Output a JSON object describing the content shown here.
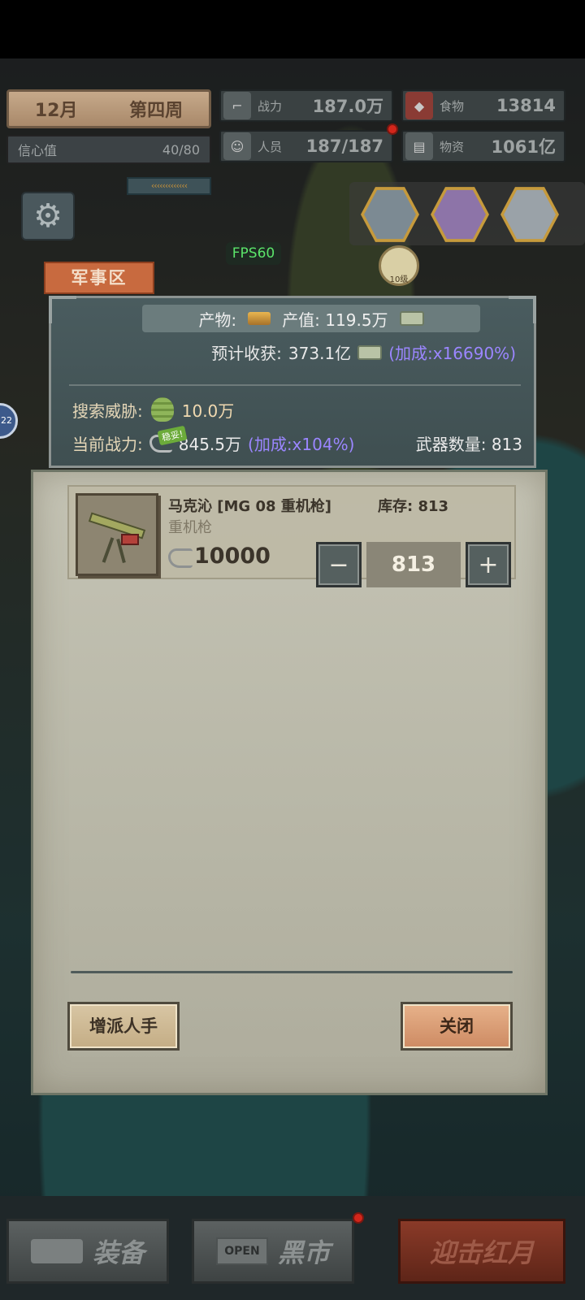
{
  "hud": {
    "month": "12月",
    "week": "第四周",
    "faith_label": "信心值",
    "faith_value": "40/80",
    "power_label": "战力",
    "power_value": "187.0万",
    "food_label": "食物",
    "food_value": "13814",
    "people_label": "人员",
    "people_value": "187/187",
    "supplies_label": "物资",
    "supplies_value": "1061亿"
  },
  "overlay": {
    "fps": "FPS60",
    "flag_level": "10级",
    "side_badge": "22"
  },
  "zone": {
    "name": "军事区"
  },
  "info": {
    "product_label": "产物:",
    "output_label": "产值: 119.5万",
    "expected_label": "预计收获:",
    "expected_value": "373.1亿",
    "expected_bonus": "(加成:x16690%)",
    "threat_label": "搜索威胁:",
    "threat_value": "10.0万",
    "safe_tag": "稳妥!",
    "current_power_label": "当前战力:",
    "current_power_value": "845.5万",
    "current_power_bonus": "(加成:x104%)",
    "weapon_count": "武器数量: 813"
  },
  "weapon": {
    "name": "马克沁 [MG 08 重机枪]",
    "stock": "库存:   813",
    "type": "重机枪",
    "power": "10000",
    "quantity": "813",
    "minus": "−",
    "plus": "+"
  },
  "buttons": {
    "assign": "增派人手",
    "close": "关闭"
  },
  "nav": {
    "equip": "装备",
    "open": "OPEN",
    "market": "黑市",
    "red_moon": "迎击红月"
  }
}
